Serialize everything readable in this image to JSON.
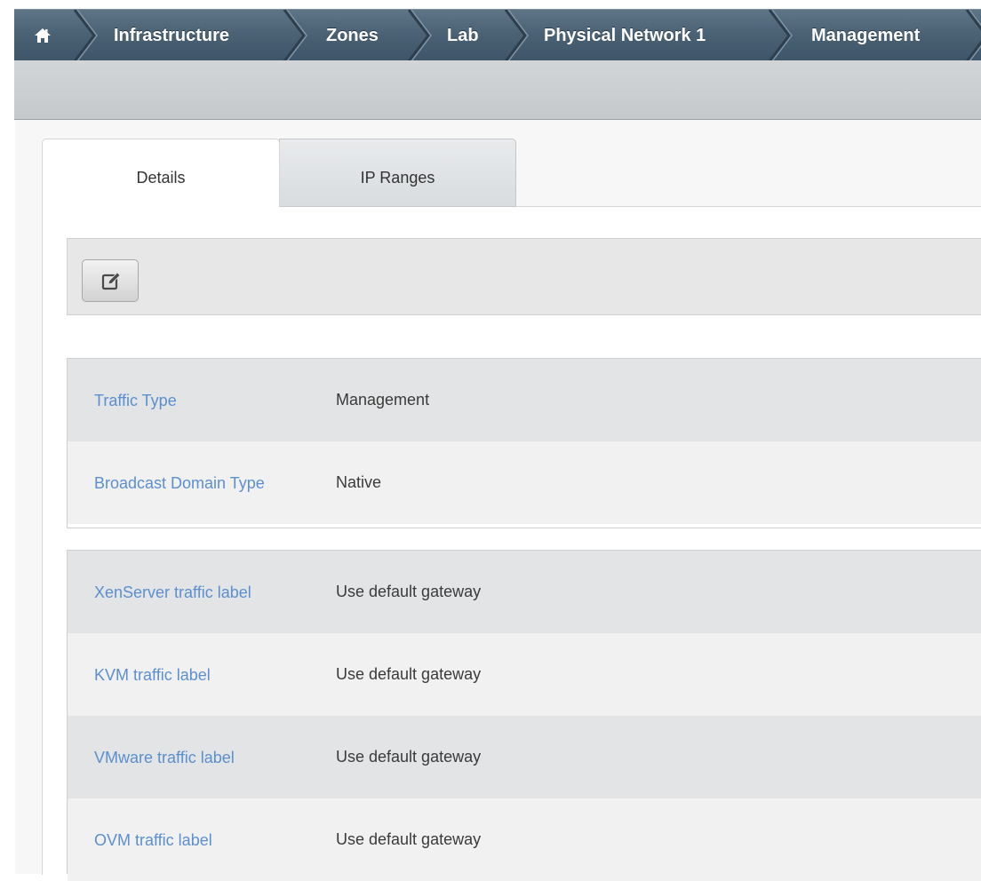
{
  "breadcrumb": {
    "home_icon": "home-icon",
    "items": [
      {
        "label": "Infrastructure"
      },
      {
        "label": "Zones"
      },
      {
        "label": "Lab"
      },
      {
        "label": "Physical Network 1"
      },
      {
        "label": "Management"
      }
    ]
  },
  "tabs": [
    {
      "label": "Details",
      "active": true
    },
    {
      "label": "IP Ranges",
      "active": false
    }
  ],
  "actions": {
    "edit_icon": "edit-icon"
  },
  "details": {
    "group1": [
      {
        "label": "Traffic Type",
        "value": "Management"
      },
      {
        "label": "Broadcast Domain Type",
        "value": "Native"
      }
    ],
    "group2": [
      {
        "label": "XenServer traffic label",
        "value": "Use default gateway"
      },
      {
        "label": "KVM traffic label",
        "value": "Use default gateway"
      },
      {
        "label": "VMware traffic label",
        "value": "Use default gateway"
      },
      {
        "label": "OVM traffic label",
        "value": "Use default gateway"
      }
    ]
  },
  "colors": {
    "breadcrumb_bg": "#4a6174",
    "label_link": "#5c8fcf",
    "row_dark": "#e3e4e5",
    "row_light": "#f2f1f1"
  }
}
